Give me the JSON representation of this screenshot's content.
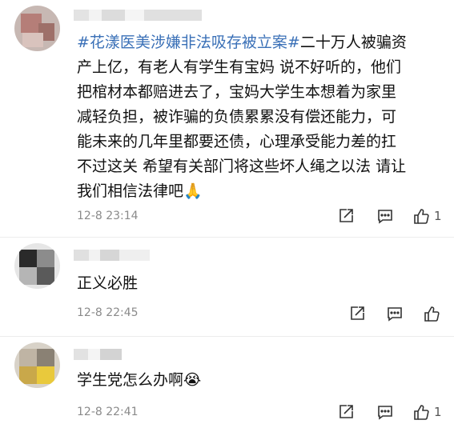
{
  "comments": [
    {
      "topic": "#花漾医美涉嫌非法吸存被立案#",
      "lines": [
        "二十万人被骗资",
        "产上亿，有老人有学生有宝妈 说不好听的，他们",
        "把棺材本都赔进去了，宝妈大学生本想着为家里",
        "减轻负担，被诈骗的负债累累没有偿还能力，可",
        "能未来的几年里都要还债，心理承受能力差的扛",
        "不过这关 希望有关部门将这些坏人绳之以法 请让",
        "我们相信法律吧🙏"
      ],
      "time": "12-8 23:14",
      "like_count": "1"
    },
    {
      "text": "正义必胜",
      "time": "12-8 22:45",
      "like_count": ""
    },
    {
      "text": "学生党怎么办啊😭",
      "time": "12-8 22:41",
      "like_count": "1"
    }
  ],
  "icons": {
    "share": "share-icon",
    "comment": "comment-icon",
    "like": "like-icon"
  },
  "colors": {
    "topic": "#3a70b7",
    "time": "#8a8a8a"
  }
}
